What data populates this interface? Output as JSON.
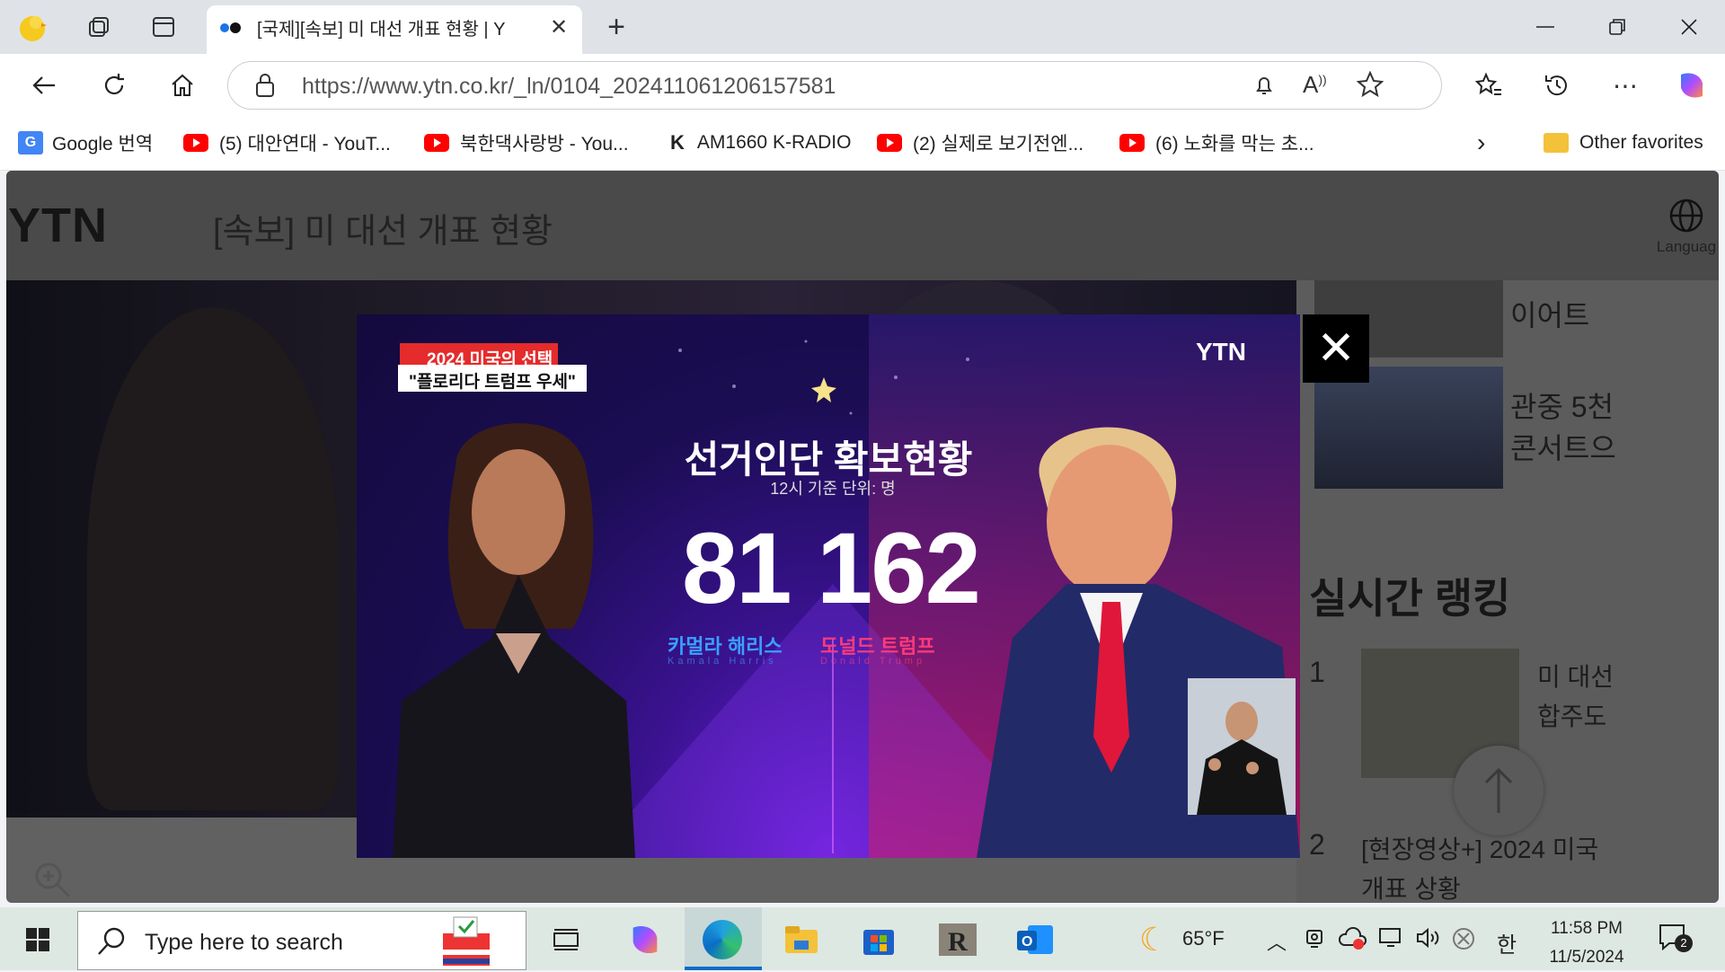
{
  "browser": {
    "tab_title": "[국제][속보] 미 대선 개표 현황 | Y",
    "url": "https://www.ytn.co.kr/_ln/0104_202411061206157581",
    "new_tab_label": "+"
  },
  "favorites": [
    {
      "label": "Google 번역"
    },
    {
      "label": "(5) 대안연대 - YouT..."
    },
    {
      "label": "북한댁사랑방 - You..."
    },
    {
      "label": "AM1660 K-RADIO"
    },
    {
      "label": "(2) 실제로 보기전엔..."
    },
    {
      "label": "(6) 노화를 막는 초..."
    }
  ],
  "other_favorites": "Other favorites",
  "page": {
    "logo": "YTN",
    "heading": "[속보] 미 대선 개표 현황",
    "language_label": "Languag",
    "side_items": [
      "이어트",
      "관중 5천",
      "콘서트으"
    ],
    "ranking_title": "실시간 랭킹",
    "rank1_num": "1",
    "rank1_text": [
      "미 대선",
      "합주도"
    ],
    "rank2_num": "2",
    "rank2_text": [
      "[현장영상+] 2024 미국",
      "개표 상황"
    ]
  },
  "modal": {
    "badge_top": "2024 미국의 선택",
    "badge_bottom": "\"플로리다 트럼프 우세\"",
    "logo": "YTN",
    "title": "선거인단 확보현황",
    "subtitle": "12시 기준   단위: 명",
    "harris_votes": "81",
    "trump_votes": "162",
    "harris_name": "카멀라 해리스",
    "harris_en": "Kamala Harris",
    "trump_name": "도널드 트럼프",
    "trump_en": "Donald Trump",
    "close": "✕"
  },
  "taskbar": {
    "search_placeholder": "Type here to search",
    "weather": "65°F",
    "ime": "한",
    "time": "11:58 PM",
    "date": "11/5/2024",
    "notifications": "2"
  },
  "colors": {
    "harris_blue": "#3aa0ff",
    "trump_pink": "#ff3a7a",
    "badge_red": "#e52b2b"
  }
}
